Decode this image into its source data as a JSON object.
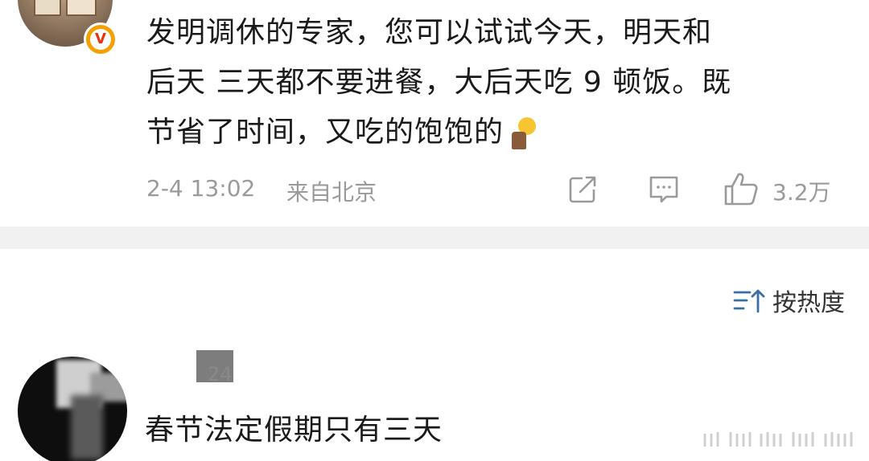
{
  "top_comment": {
    "lines": [
      "发明调休的专家，您可以试试今天，明天和",
      "后天 三天都不要进餐，大后天吃 9 顿饭。既",
      "节省了时间，又吃的饱饱的"
    ],
    "verified_badge": "V",
    "timestamp": "2-4 13:02",
    "location": "来自北京",
    "like_count": "3.2万",
    "icons": {
      "share": "share-icon",
      "comment": "comment-icon",
      "like": "thumbs-up-icon",
      "emoji": "lightbulb-man-emoji"
    }
  },
  "sort": {
    "label": "按热度",
    "icon": "sort-icon"
  },
  "reply": {
    "level": "24",
    "text": "春节法定假期只有三天"
  },
  "colors": {
    "text_primary": "#1a1a1a",
    "text_secondary": "#9a9a9a",
    "divider": "#f1f1f1",
    "badge_orange": "#f2a100",
    "badge_red": "#e8320e"
  }
}
